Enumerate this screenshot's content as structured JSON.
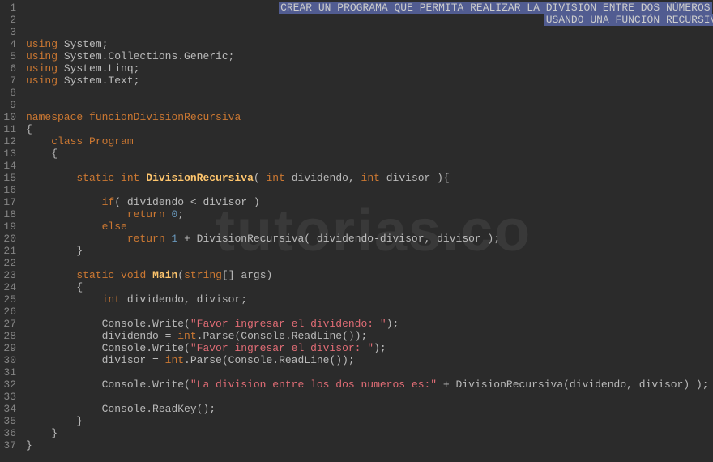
{
  "watermark": "tutorias.co",
  "highlight_line1": "CREAR UN PROGRAMA QUE PERMITA REALIZAR LA DIVISIÓN ENTRE DOS NÚMEROS",
  "highlight_line2": "USANDO UNA FUNCIÓN RECURSIVA",
  "chart_data": {
    "type": "table",
    "language": "csharp",
    "lines": [
      {
        "n": 1,
        "indent": "                                        ",
        "tokens": [
          {
            "t": "highlight",
            "v": "CREAR UN PROGRAMA QUE PERMITA REALIZAR LA DIVISIÓN ENTRE DOS NÚMEROS"
          }
        ]
      },
      {
        "n": 2,
        "indent": "                                                                                  ",
        "tokens": [
          {
            "t": "highlight",
            "v": "USANDO UNA FUNCIÓN RECURSIVA"
          }
        ]
      },
      {
        "n": 3,
        "indent": "",
        "tokens": []
      },
      {
        "n": 4,
        "indent": "",
        "tokens": [
          {
            "t": "kw",
            "v": "using"
          },
          {
            "t": "punct",
            "v": " System;"
          }
        ]
      },
      {
        "n": 5,
        "indent": "",
        "tokens": [
          {
            "t": "kw",
            "v": "using"
          },
          {
            "t": "punct",
            "v": " System.Collections.Generic;"
          }
        ]
      },
      {
        "n": 6,
        "indent": "",
        "tokens": [
          {
            "t": "kw",
            "v": "using"
          },
          {
            "t": "punct",
            "v": " System.Linq;"
          }
        ]
      },
      {
        "n": 7,
        "indent": "",
        "tokens": [
          {
            "t": "kw",
            "v": "using"
          },
          {
            "t": "punct",
            "v": " System.Text;"
          }
        ]
      },
      {
        "n": 8,
        "indent": "",
        "tokens": []
      },
      {
        "n": 9,
        "indent": "",
        "tokens": []
      },
      {
        "n": 10,
        "indent": "",
        "tokens": [
          {
            "t": "kw",
            "v": "namespace"
          },
          {
            "t": "punct",
            "v": " "
          },
          {
            "t": "nsname",
            "v": "funcionDivisionRecursiva"
          }
        ]
      },
      {
        "n": 11,
        "indent": "",
        "tokens": [
          {
            "t": "punct",
            "v": "{"
          }
        ]
      },
      {
        "n": 12,
        "indent": "    ",
        "tokens": [
          {
            "t": "kw",
            "v": "class"
          },
          {
            "t": "punct",
            "v": " "
          },
          {
            "t": "clsname",
            "v": "Program"
          }
        ]
      },
      {
        "n": 13,
        "indent": "    ",
        "tokens": [
          {
            "t": "punct",
            "v": "{"
          }
        ]
      },
      {
        "n": 14,
        "indent": "",
        "tokens": []
      },
      {
        "n": 15,
        "indent": "        ",
        "tokens": [
          {
            "t": "kw",
            "v": "static"
          },
          {
            "t": "punct",
            "v": " "
          },
          {
            "t": "inttype",
            "v": "int"
          },
          {
            "t": "punct",
            "v": " "
          },
          {
            "t": "fn",
            "v": "DivisionRecursiva"
          },
          {
            "t": "punct",
            "v": "( "
          },
          {
            "t": "inttype",
            "v": "int"
          },
          {
            "t": "punct",
            "v": " dividendo, "
          },
          {
            "t": "inttype",
            "v": "int"
          },
          {
            "t": "punct",
            "v": " divisor ){"
          }
        ]
      },
      {
        "n": 16,
        "indent": "",
        "tokens": []
      },
      {
        "n": 17,
        "indent": "            ",
        "tokens": [
          {
            "t": "kw",
            "v": "if"
          },
          {
            "t": "punct",
            "v": "( dividendo < divisor )"
          }
        ]
      },
      {
        "n": 18,
        "indent": "                ",
        "tokens": [
          {
            "t": "kw",
            "v": "return"
          },
          {
            "t": "punct",
            "v": " "
          },
          {
            "t": "num",
            "v": "0"
          },
          {
            "t": "punct",
            "v": ";"
          }
        ]
      },
      {
        "n": 19,
        "indent": "            ",
        "tokens": [
          {
            "t": "kw",
            "v": "else"
          }
        ]
      },
      {
        "n": 20,
        "indent": "                ",
        "tokens": [
          {
            "t": "kw",
            "v": "return"
          },
          {
            "t": "punct",
            "v": " "
          },
          {
            "t": "num",
            "v": "1"
          },
          {
            "t": "punct",
            "v": " + DivisionRecursiva( dividendo-divisor, divisor );"
          }
        ]
      },
      {
        "n": 21,
        "indent": "        ",
        "tokens": [
          {
            "t": "punct",
            "v": "}"
          }
        ]
      },
      {
        "n": 22,
        "indent": "",
        "tokens": []
      },
      {
        "n": 23,
        "indent": "        ",
        "tokens": [
          {
            "t": "kw",
            "v": "static"
          },
          {
            "t": "punct",
            "v": " "
          },
          {
            "t": "kw",
            "v": "void"
          },
          {
            "t": "punct",
            "v": " "
          },
          {
            "t": "fn",
            "v": "Main"
          },
          {
            "t": "punct",
            "v": "("
          },
          {
            "t": "inttype",
            "v": "string"
          },
          {
            "t": "punct",
            "v": "[] args)"
          }
        ]
      },
      {
        "n": 24,
        "indent": "        ",
        "tokens": [
          {
            "t": "punct",
            "v": "{"
          }
        ]
      },
      {
        "n": 25,
        "indent": "            ",
        "tokens": [
          {
            "t": "inttype",
            "v": "int"
          },
          {
            "t": "punct",
            "v": " dividendo, divisor;"
          }
        ]
      },
      {
        "n": 26,
        "indent": "",
        "tokens": []
      },
      {
        "n": 27,
        "indent": "            ",
        "tokens": [
          {
            "t": "punct",
            "v": "Console.Write("
          },
          {
            "t": "str",
            "v": "\"Favor ingresar el dividendo: \""
          },
          {
            "t": "punct",
            "v": ");"
          }
        ]
      },
      {
        "n": 28,
        "indent": "            ",
        "tokens": [
          {
            "t": "punct",
            "v": "dividendo = "
          },
          {
            "t": "inttype",
            "v": "int"
          },
          {
            "t": "punct",
            "v": ".Parse(Console.ReadLine());"
          }
        ]
      },
      {
        "n": 29,
        "indent": "            ",
        "tokens": [
          {
            "t": "punct",
            "v": "Console.Write("
          },
          {
            "t": "str",
            "v": "\"Favor ingresar el divisor: \""
          },
          {
            "t": "punct",
            "v": ");"
          }
        ]
      },
      {
        "n": 30,
        "indent": "            ",
        "tokens": [
          {
            "t": "punct",
            "v": "divisor = "
          },
          {
            "t": "inttype",
            "v": "int"
          },
          {
            "t": "punct",
            "v": ".Parse(Console.ReadLine());"
          }
        ]
      },
      {
        "n": 31,
        "indent": "",
        "tokens": []
      },
      {
        "n": 32,
        "indent": "            ",
        "tokens": [
          {
            "t": "punct",
            "v": "Console.Write("
          },
          {
            "t": "str",
            "v": "\"La division entre los dos numeros es:\""
          },
          {
            "t": "punct",
            "v": " + DivisionRecursiva(dividendo, divisor) );"
          }
        ]
      },
      {
        "n": 33,
        "indent": "",
        "tokens": []
      },
      {
        "n": 34,
        "indent": "            ",
        "tokens": [
          {
            "t": "punct",
            "v": "Console.ReadKey();"
          }
        ]
      },
      {
        "n": 35,
        "indent": "        ",
        "tokens": [
          {
            "t": "punct",
            "v": "}"
          }
        ]
      },
      {
        "n": 36,
        "indent": "    ",
        "tokens": [
          {
            "t": "punct",
            "v": "}"
          }
        ]
      },
      {
        "n": 37,
        "indent": "",
        "tokens": [
          {
            "t": "punct",
            "v": "}"
          }
        ]
      }
    ]
  }
}
